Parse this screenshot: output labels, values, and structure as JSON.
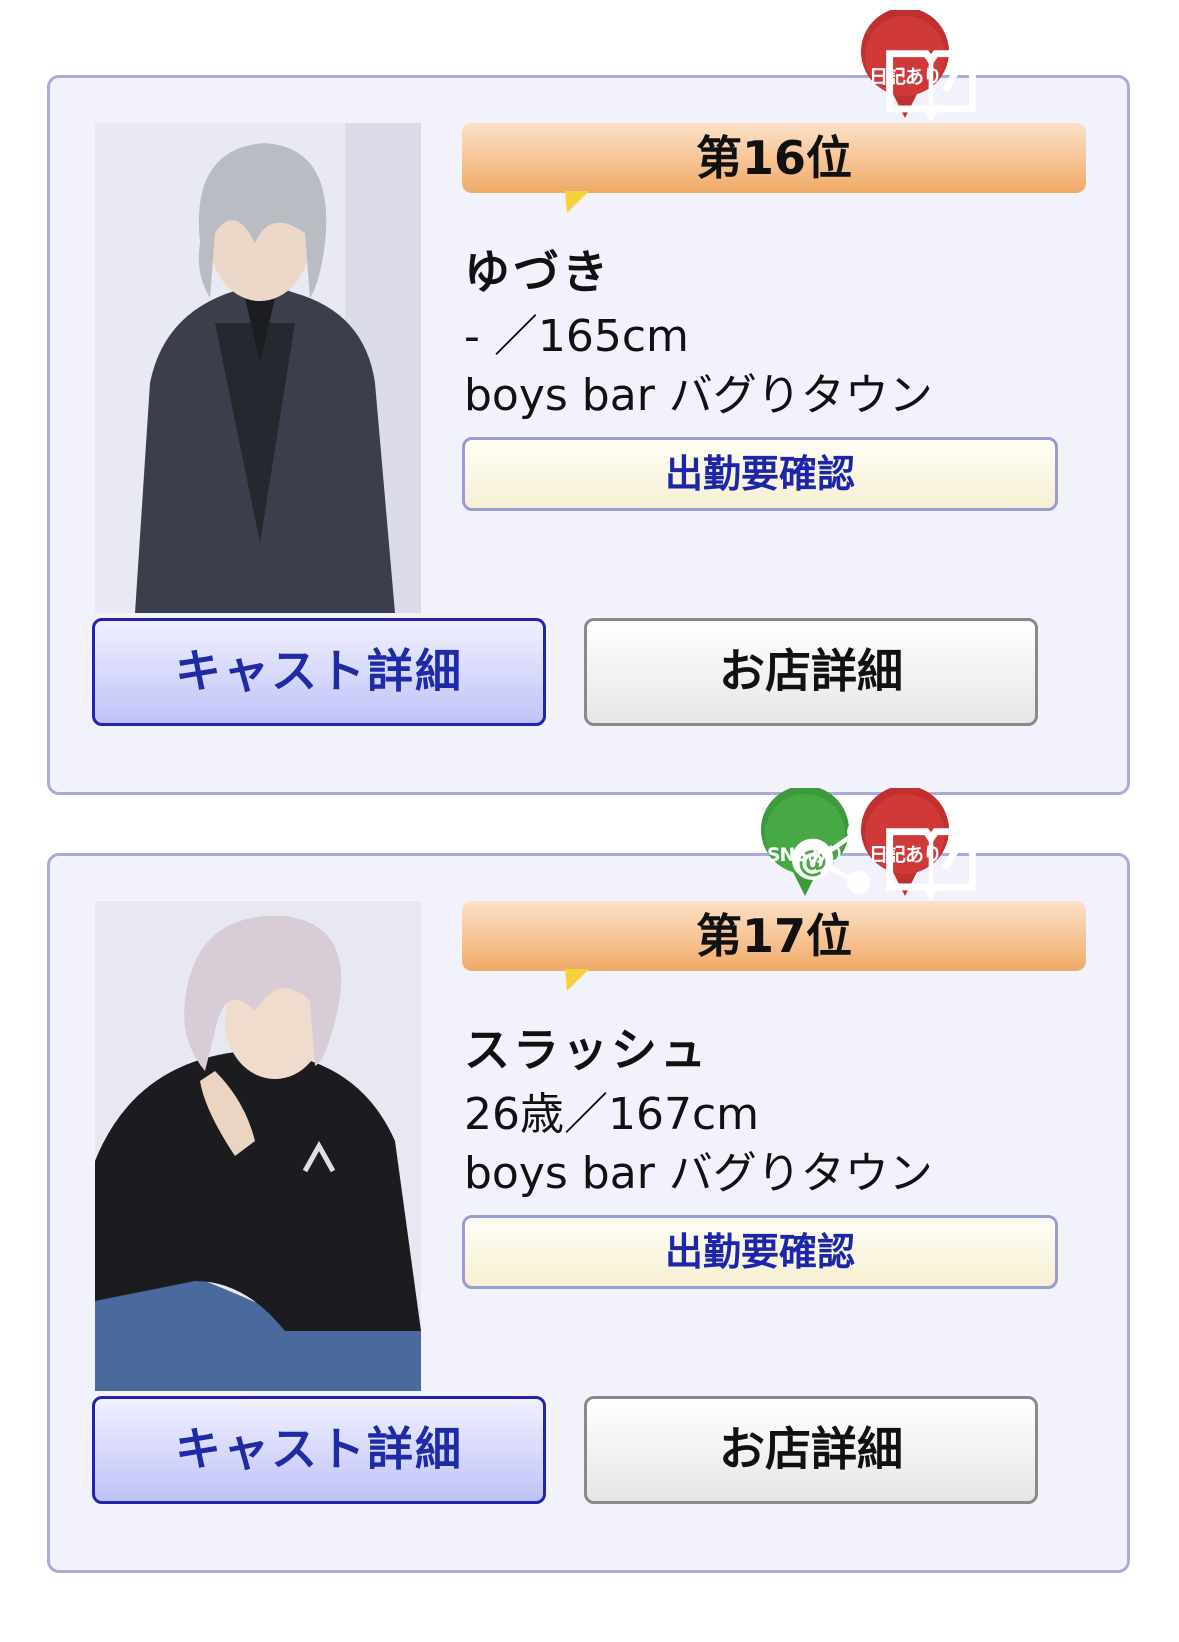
{
  "cards": [
    {
      "rank": "第16位",
      "name": "ゆづき",
      "stats": " - ／165cm",
      "shop": "boys bar バグりタウン",
      "attendance": "出勤要確認",
      "cast_button": "キャスト詳細",
      "shop_button": "お店詳細",
      "badges": [
        {
          "type": "diary",
          "label": "日記あり",
          "icon": "diary-icon",
          "color": "#c0302f"
        }
      ]
    },
    {
      "rank": "第17位",
      "name": "スラッシュ",
      "stats": "26歳／167cm",
      "shop": "boys bar バグりタウン",
      "attendance": "出勤要確認",
      "cast_button": "キャスト詳細",
      "shop_button": "お店詳細",
      "badges": [
        {
          "type": "sns",
          "label": "SNSあり",
          "icon": "sns-icon",
          "color": "#3c9a3a"
        },
        {
          "type": "diary",
          "label": "日記あり",
          "icon": "diary-icon",
          "color": "#c0302f"
        }
      ]
    }
  ]
}
